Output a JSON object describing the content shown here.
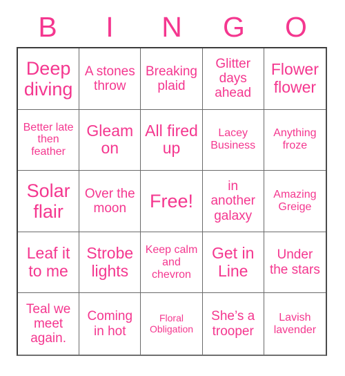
{
  "card": {
    "title": "BINGO",
    "accent_color": "#f4378f",
    "border_color": "#6a6a6a",
    "background_color": "#ffffff",
    "columns": 5,
    "rows": 5
  },
  "header": {
    "letters": [
      "B",
      "I",
      "N",
      "G",
      "O"
    ]
  },
  "grid": {
    "cells": [
      {
        "text": "Deep diving",
        "size": "xl",
        "free": false
      },
      {
        "text": "A stones throw",
        "size": "md",
        "free": false
      },
      {
        "text": "Breaking plaid",
        "size": "md",
        "free": false
      },
      {
        "text": "Glitter days ahead",
        "size": "md",
        "free": false
      },
      {
        "text": "Flower flower",
        "size": "lg",
        "free": false
      },
      {
        "text": "Better late then feather",
        "size": "sm",
        "free": false
      },
      {
        "text": "Gleam on",
        "size": "lg",
        "free": false
      },
      {
        "text": "All fired up",
        "size": "lg",
        "free": false
      },
      {
        "text": "Lacey Business",
        "size": "sm",
        "free": false
      },
      {
        "text": "Anything froze",
        "size": "sm",
        "free": false
      },
      {
        "text": "Solar flair",
        "size": "xl",
        "free": false
      },
      {
        "text": "Over the moon",
        "size": "md",
        "free": false
      },
      {
        "text": "Free!",
        "size": "xl",
        "free": true
      },
      {
        "text": "in another galaxy",
        "size": "md",
        "free": false
      },
      {
        "text": "Amazing Greige",
        "size": "sm",
        "free": false
      },
      {
        "text": "Leaf it to me",
        "size": "lg",
        "free": false
      },
      {
        "text": "Strobe lights",
        "size": "lg",
        "free": false
      },
      {
        "text": "Keep calm and chevron",
        "size": "sm",
        "free": false
      },
      {
        "text": "Get in Line",
        "size": "lg",
        "free": false
      },
      {
        "text": "Under the stars",
        "size": "md",
        "free": false
      },
      {
        "text": "Teal we meet again.",
        "size": "md",
        "free": false
      },
      {
        "text": "Coming in hot",
        "size": "md",
        "free": false
      },
      {
        "text": "Floral Obligation",
        "size": "xs",
        "free": false
      },
      {
        "text": "She’s a trooper",
        "size": "md",
        "free": false
      },
      {
        "text": "Lavish lavender",
        "size": "sm",
        "free": false
      }
    ]
  }
}
